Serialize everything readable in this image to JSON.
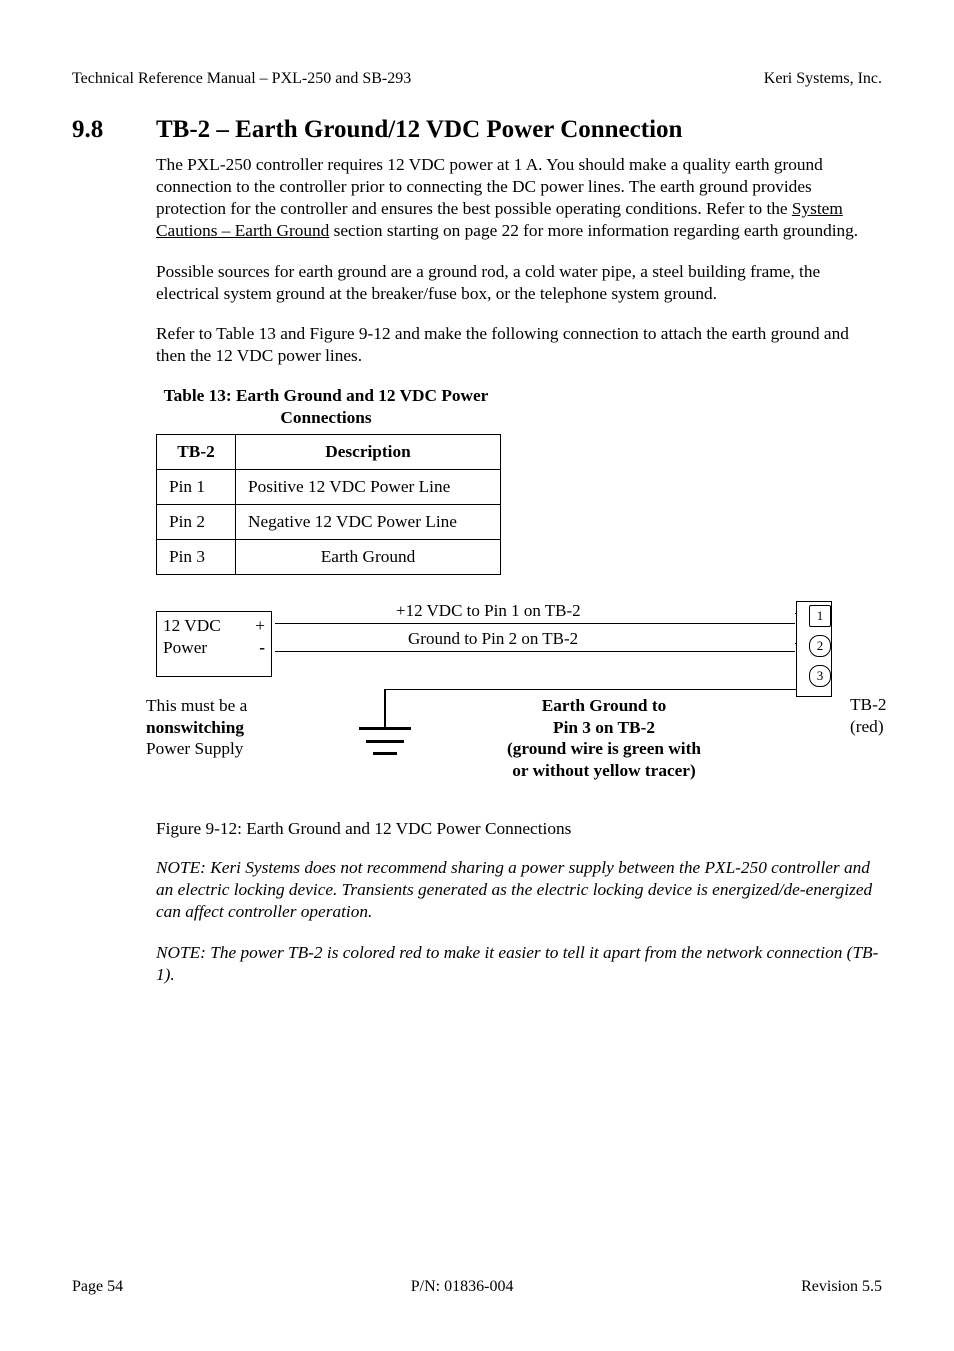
{
  "header": {
    "left": "Technical Reference Manual – PXL-250 and SB-293",
    "right": "Keri Systems, Inc."
  },
  "section": {
    "number": "9.8",
    "title": "TB-2 – Earth Ground/12 VDC Power Connection"
  },
  "paragraphs": {
    "p1a": "The PXL-250 controller requires 12 VDC power at 1 A. You should make a quality earth ground connection to the controller prior to connecting the DC power lines. The earth ground provides protection for the controller and ensures the best possible operating conditions. Refer to the ",
    "p1_link": "System Cautions – Earth Ground",
    "p1b": " section starting on page 22 for more information regarding earth grounding.",
    "p2": "Possible sources for earth ground are a ground rod, a cold water pipe, a steel building frame, the electrical system ground at the breaker/fuse box, or the telephone system ground.",
    "p3": "Refer to Table 13 and Figure 9-12 and make the following connection to attach the earth ground and then the 12 VDC power lines."
  },
  "table": {
    "caption": "Table 13: Earth Ground and 12 VDC Power Connections",
    "col1_header": "TB-2",
    "col2_header": "Description",
    "rows": [
      {
        "c1": "Pin 1",
        "c2": "Positive 12 VDC Power Line"
      },
      {
        "c1": "Pin 2",
        "c2": "Negative 12 VDC Power Line"
      },
      {
        "c1": "Pin 3",
        "c2": "Earth Ground"
      }
    ]
  },
  "diagram": {
    "vdc_box_line1": "12 VDC",
    "vdc_box_line2": "Power",
    "plus": "+",
    "minus": "-",
    "wire1": "+12 VDC to Pin 1 on TB-2",
    "wire2": "Ground to Pin 2 on TB-2",
    "left_note_l1": "This must be a",
    "left_note_l2": "nonswitching",
    "left_note_l3": "Power Supply",
    "earth_l1": "Earth Ground to",
    "earth_l2": "Pin 3 on TB-2",
    "earth_l3": "(ground wire is green with",
    "earth_l4": "or without yellow tracer)",
    "tb2": "TB-2",
    "red": "(red)",
    "pin1": "1",
    "pin2": "2",
    "pin3": "3"
  },
  "figure_caption": "Figure 9-12: Earth Ground and 12 VDC Power Connections",
  "notes": {
    "n1": "NOTE: Keri Systems does not recommend sharing a power supply between the PXL-250 controller and an electric locking device. Transients generated as the electric locking device is energized/de-energized can affect controller operation.",
    "n2": "NOTE: The power TB-2 is colored red to make it easier to tell it apart from the network connection (TB-1)."
  },
  "footer": {
    "left": "Page 54",
    "center": "P/N: 01836-004",
    "right": "Revision 5.5"
  }
}
